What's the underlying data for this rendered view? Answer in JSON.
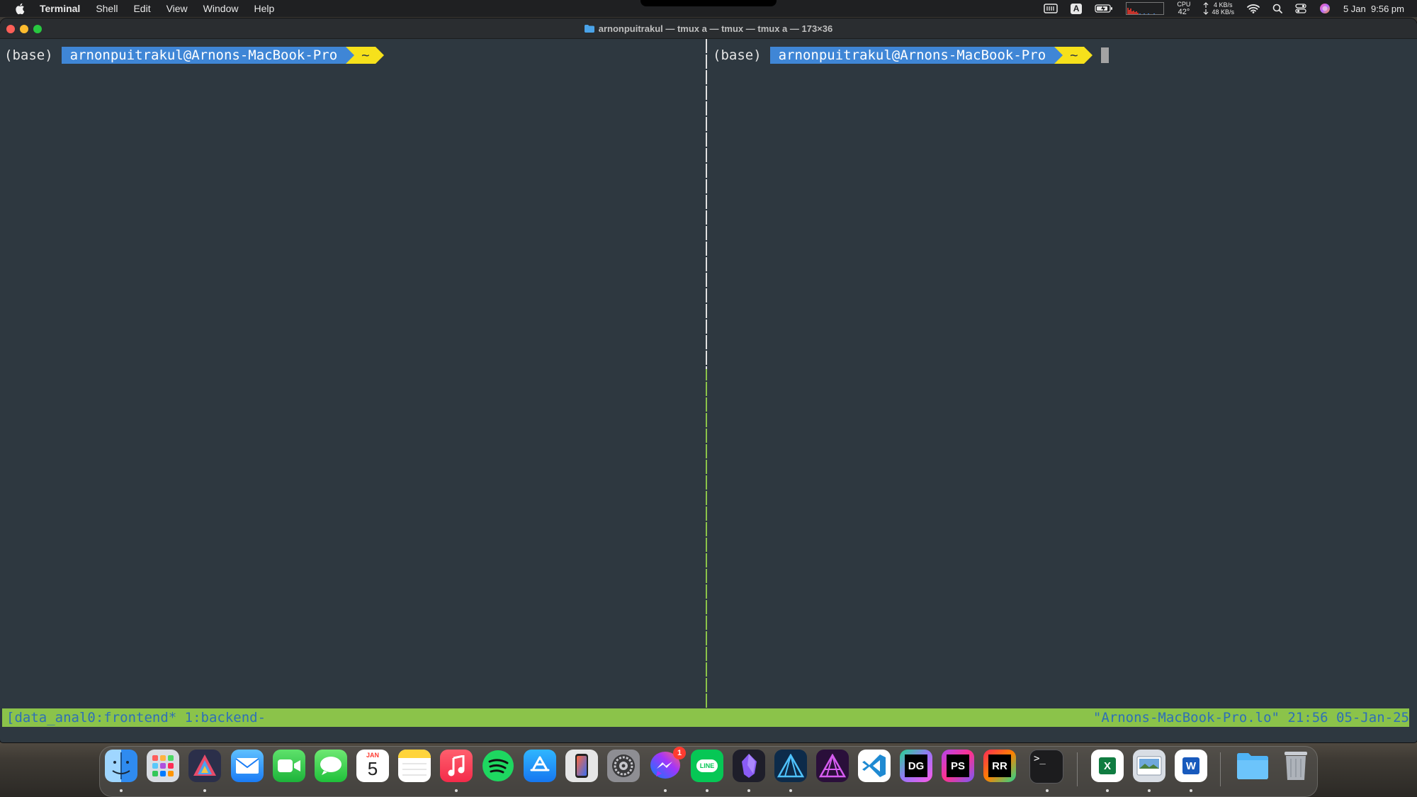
{
  "menubar": {
    "app_name": "Terminal",
    "items": [
      "Shell",
      "Edit",
      "View",
      "Window",
      "Help"
    ],
    "status": {
      "input_letter": "A",
      "cpu_label": "CPU",
      "cpu_temp": "42°",
      "net_up": "4 KB/s",
      "net_down": "48 KB/s",
      "date": "5 Jan",
      "time": "9:56 pm"
    }
  },
  "window": {
    "title": "arnonpuitrakul — tmux a — tmux — tmux a — 173×36"
  },
  "panes": [
    {
      "env": "(base)",
      "user_host": "arnonpuitrakul@Arnons-MacBook-Pro",
      "dir": "~",
      "active": false
    },
    {
      "env": "(base)",
      "user_host": "arnonpuitrakul@Arnons-MacBook-Pro",
      "dir": "~",
      "active": true
    }
  ],
  "tmux_status": {
    "left": "[data_anal0:frontend* 1:backend-",
    "right": "\"Arnons-MacBook-Pro.lo\" 21:56 05-Jan-25"
  },
  "colors": {
    "terminal_bg": "#2e3840",
    "prompt_user_bg": "#3f86d6",
    "prompt_dir_bg": "#f6e11b",
    "tmux_bar": "#8bc34a",
    "tmux_text": "#2e6fb6"
  },
  "dock": {
    "calendar_month": "JAN",
    "calendar_day": "5",
    "messenger_badge": "1",
    "apps": [
      "finder-icon",
      "launchpad-icon",
      "affinity-icon",
      "mail-icon",
      "facetime-icon",
      "messages-icon",
      "calendar-icon",
      "notes-icon",
      "music-icon",
      "spotify-icon",
      "app-store-icon",
      "iphone-mirroring-icon",
      "system-settings-icon",
      "messenger-icon",
      "line-icon",
      "obsidian-icon",
      "affinity-designer-icon",
      "affinity-photo-icon",
      "vscode-icon",
      "datagrip-icon",
      "phpstorm-icon",
      "rustrover-icon",
      "terminal-icon",
      "excel-icon",
      "preview-icon",
      "word-icon",
      "downloads-folder-icon",
      "trash-icon"
    ],
    "line_label": "LINE",
    "datagrip_label": "DG",
    "phpstorm_label": "PS",
    "rustrover_label": "RR",
    "terminal_label": ">_",
    "excel_label": "X",
    "word_label": "W"
  }
}
